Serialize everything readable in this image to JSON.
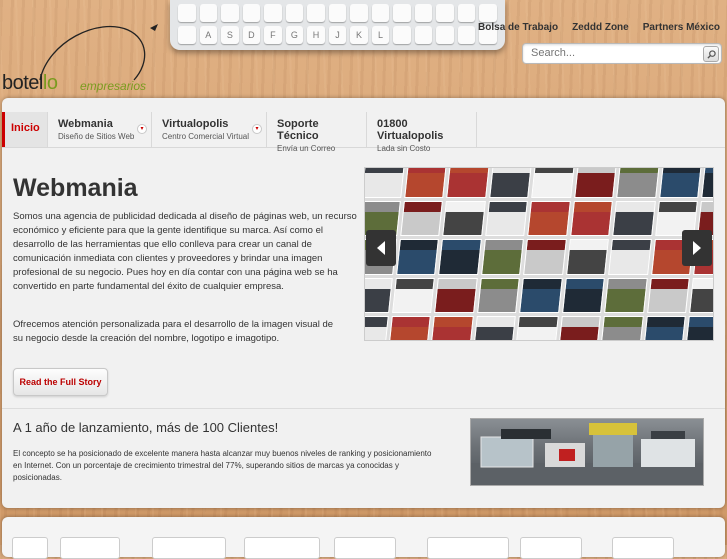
{
  "keyboard": {
    "keys": [
      "",
      "",
      "",
      "",
      "",
      "",
      "",
      "",
      "",
      "",
      "",
      "",
      "",
      "",
      "",
      "",
      "A",
      "S",
      "D",
      "F",
      "G",
      "H",
      "J",
      "K",
      "L",
      "",
      "",
      "",
      "",
      ""
    ]
  },
  "logo": {
    "name_part1": "botel",
    "name_part2": "lo",
    "tagline": "empresarios"
  },
  "top_links": [
    "Bolsa de Trabajo",
    "Zeddd Zone",
    "Partners México"
  ],
  "search": {
    "placeholder": "Search..."
  },
  "nav": [
    {
      "title": "Inicio",
      "sub": "",
      "active": true
    },
    {
      "title": "Webmania",
      "sub": "Diseño de Sitios Web",
      "caret": true
    },
    {
      "title": "Virtualopolis",
      "sub": "Centro Comercial Virtual",
      "caret": true
    },
    {
      "title": "Soporte Técnico",
      "sub": "Envía un Correo"
    },
    {
      "title": "01800 Virtualopolis",
      "sub": "Lada sin Costo"
    }
  ],
  "hero": {
    "title": "Webmania",
    "paragraph1": "Somos una agencia de publicidad dedicada al diseño de páginas web, un recurso económico y eficiente para que la gente identifique su marca. Así como el desarrollo de las herramientas que ello conlleva para crear un canal de comunicación inmediata con clientes y proveedores y brindar una imagen profesional de su negocio. Pues hoy en día contar con una página web se ha convertido en parte fundamental del éxito de cualquier empresa.",
    "paragraph2": "Ofrecemos atención personalizada para el desarrollo de la imagen visual de su negocio desde la creación del nombre, logotipo e imagotipo.",
    "button": "Read the Full Story"
  },
  "slider": {
    "prev_icon": "arrow-left-icon",
    "next_icon": "arrow-right-icon"
  },
  "section": {
    "title": "A 1 año de lanzamiento, más de 100 Clientes!",
    "text": "El concepto se ha posicionado de excelente manera hasta alcanzar muy buenos niveles de ranking y posicionamiento en Internet. Con un porcentaje de crecimiento trimestral del 77%, superando sitios de marcas ya conocidas y posicionadas."
  },
  "colors": {
    "accent": "#cc0000",
    "wood": "#d9a673",
    "panel": "#f1f1f1"
  }
}
